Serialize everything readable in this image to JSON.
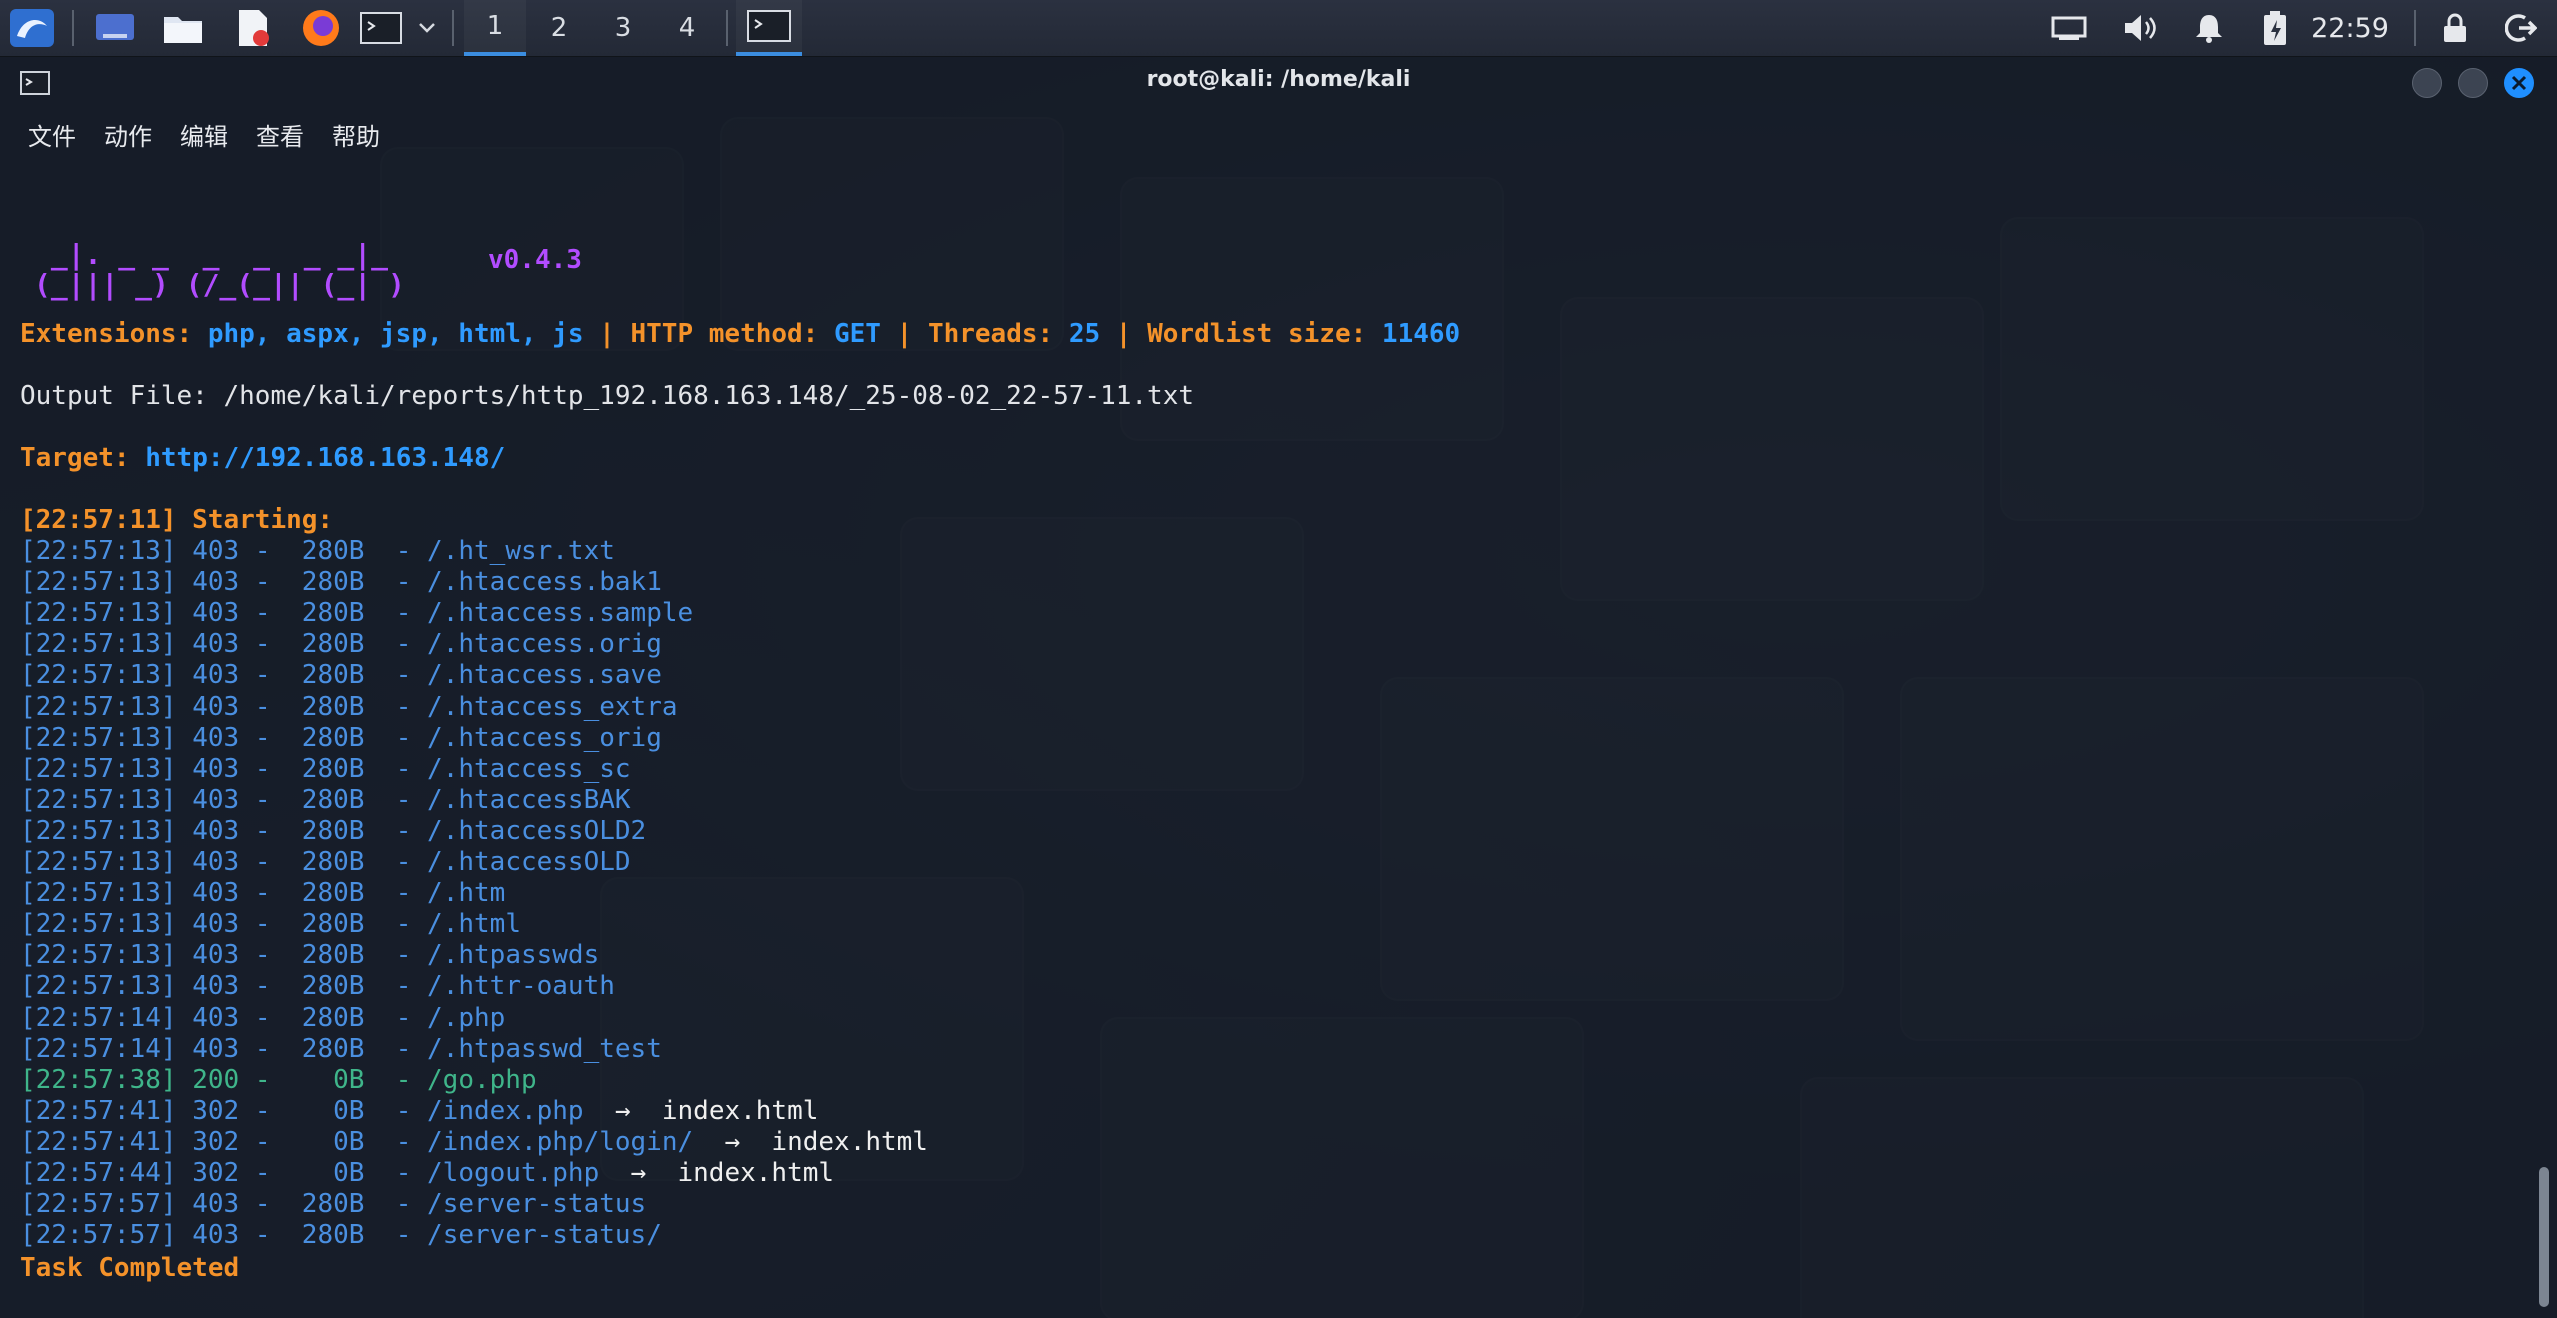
{
  "taskbar": {
    "workspaces": [
      "1",
      "2",
      "3",
      "4"
    ],
    "active_workspace": "1",
    "clock": "22:59",
    "icons": [
      "kali-menu-icon",
      "desktop-icon",
      "file-manager-icon",
      "text-editor-icon",
      "firefox-icon",
      "terminal-icon",
      "dropdown-chevron-icon",
      "active-terminal-icon",
      "network-icon",
      "volume-icon",
      "notification-bell-icon",
      "battery-icon",
      "lock-icon",
      "logout-icon"
    ]
  },
  "window": {
    "title": "root@kali: /home/kali",
    "menu": [
      "文件",
      "动作",
      "编辑",
      "查看",
      "帮助"
    ]
  },
  "terminal": {
    "banner_line1": " _|. _ _  _  _  _ _|_",
    "banner_line2": "(_||| _) (/_(_|| (_| )",
    "version": "v0.4.3",
    "info": {
      "ext_label": "Extensions: ",
      "ext_value": "php, aspx, jsp, html, js",
      "sep": " | ",
      "method_label": "HTTP method: ",
      "method_value": "GET",
      "threads_label": "Threads: ",
      "threads_value": "25",
      "wordlist_label": "Wordlist size: ",
      "wordlist_value": "11460"
    },
    "output_file": "Output File: /home/kali/reports/http_192.168.163.148/_25-08-02_22-57-11.txt",
    "target_label": "Target: ",
    "target_url": "http://192.168.163.148/",
    "starting": "[22:57:11] Starting: ",
    "results": [
      {
        "time": "[22:57:13]",
        "status": "403",
        "size": "280B",
        "path": "/.ht_wsr.txt",
        "redirect": ""
      },
      {
        "time": "[22:57:13]",
        "status": "403",
        "size": "280B",
        "path": "/.htaccess.bak1",
        "redirect": ""
      },
      {
        "time": "[22:57:13]",
        "status": "403",
        "size": "280B",
        "path": "/.htaccess.sample",
        "redirect": ""
      },
      {
        "time": "[22:57:13]",
        "status": "403",
        "size": "280B",
        "path": "/.htaccess.orig",
        "redirect": ""
      },
      {
        "time": "[22:57:13]",
        "status": "403",
        "size": "280B",
        "path": "/.htaccess.save",
        "redirect": ""
      },
      {
        "time": "[22:57:13]",
        "status": "403",
        "size": "280B",
        "path": "/.htaccess_extra",
        "redirect": ""
      },
      {
        "time": "[22:57:13]",
        "status": "403",
        "size": "280B",
        "path": "/.htaccess_orig",
        "redirect": ""
      },
      {
        "time": "[22:57:13]",
        "status": "403",
        "size": "280B",
        "path": "/.htaccess_sc",
        "redirect": ""
      },
      {
        "time": "[22:57:13]",
        "status": "403",
        "size": "280B",
        "path": "/.htaccessBAK",
        "redirect": ""
      },
      {
        "time": "[22:57:13]",
        "status": "403",
        "size": "280B",
        "path": "/.htaccessOLD2",
        "redirect": ""
      },
      {
        "time": "[22:57:13]",
        "status": "403",
        "size": "280B",
        "path": "/.htaccessOLD",
        "redirect": ""
      },
      {
        "time": "[22:57:13]",
        "status": "403",
        "size": "280B",
        "path": "/.htm",
        "redirect": ""
      },
      {
        "time": "[22:57:13]",
        "status": "403",
        "size": "280B",
        "path": "/.html",
        "redirect": ""
      },
      {
        "time": "[22:57:13]",
        "status": "403",
        "size": "280B",
        "path": "/.htpasswds",
        "redirect": ""
      },
      {
        "time": "[22:57:13]",
        "status": "403",
        "size": "280B",
        "path": "/.httr-oauth",
        "redirect": ""
      },
      {
        "time": "[22:57:14]",
        "status": "403",
        "size": "280B",
        "path": "/.php",
        "redirect": ""
      },
      {
        "time": "[22:57:14]",
        "status": "403",
        "size": "280B",
        "path": "/.htpasswd_test",
        "redirect": ""
      },
      {
        "time": "[22:57:38]",
        "status": "200",
        "size": "0B",
        "path": "/go.php",
        "redirect": ""
      },
      {
        "time": "[22:57:41]",
        "status": "302",
        "size": "0B",
        "path": "/index.php",
        "redirect": "index.html"
      },
      {
        "time": "[22:57:41]",
        "status": "302",
        "size": "0B",
        "path": "/index.php/login/",
        "redirect": "index.html"
      },
      {
        "time": "[22:57:44]",
        "status": "302",
        "size": "0B",
        "path": "/logout.php",
        "redirect": "index.html"
      },
      {
        "time": "[22:57:57]",
        "status": "403",
        "size": "280B",
        "path": "/server-status",
        "redirect": ""
      },
      {
        "time": "[22:57:57]",
        "status": "403",
        "size": "280B",
        "path": "/server-status/",
        "redirect": ""
      }
    ],
    "arrow": "→",
    "done": "Task Completed"
  },
  "colors": {
    "accent": "#3b8de0",
    "orange": "#f4922a",
    "blue": "#2f9bff",
    "green": "#3fb58a",
    "purple": "#b24cff"
  }
}
